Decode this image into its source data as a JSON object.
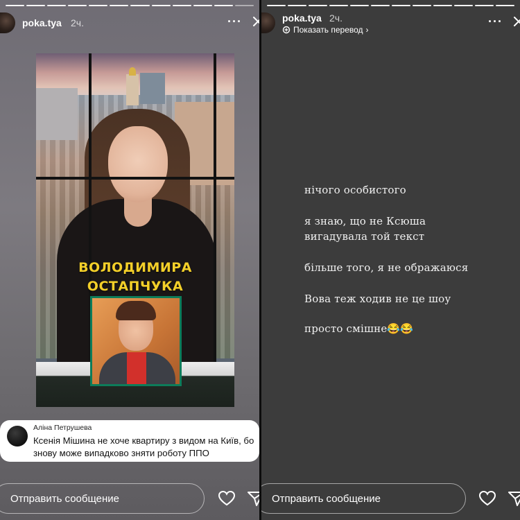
{
  "left_story": {
    "username": "poka.tya",
    "time": "2ч.",
    "progress_segments": 12,
    "progress_done": 11,
    "video": {
      "caption_line1": "ВОЛОДИМИРА",
      "caption_line2": "ОСТАПЧУКА"
    },
    "comment": {
      "author": "Аліна Петрушева",
      "text": "Ксенія Мішина не хоче квартиру з видом на Київ, бо знову може випадково зняти роботу ППО"
    },
    "reply_placeholder": "Отправить сообщение"
  },
  "right_story": {
    "username": "poka.tya",
    "time": "2ч.",
    "translate_label": "Показать перевод",
    "progress_segments": 12,
    "progress_done": 12,
    "lines": {
      "l1": "нічого особистого",
      "l2": "я знаю, що не Ксюша",
      "l3": "вигадувала той текст",
      "l4": "більше того, я не ображаюся",
      "l5": "Вова теж ходив не це шоу",
      "l6": "просто смішне😂😂"
    },
    "reply_placeholder": "Отправить сообщение"
  },
  "icons": {
    "more": "more-dots-icon",
    "close": "close-icon",
    "heart": "heart-icon",
    "send": "send-icon",
    "translate": "translate-icon"
  }
}
